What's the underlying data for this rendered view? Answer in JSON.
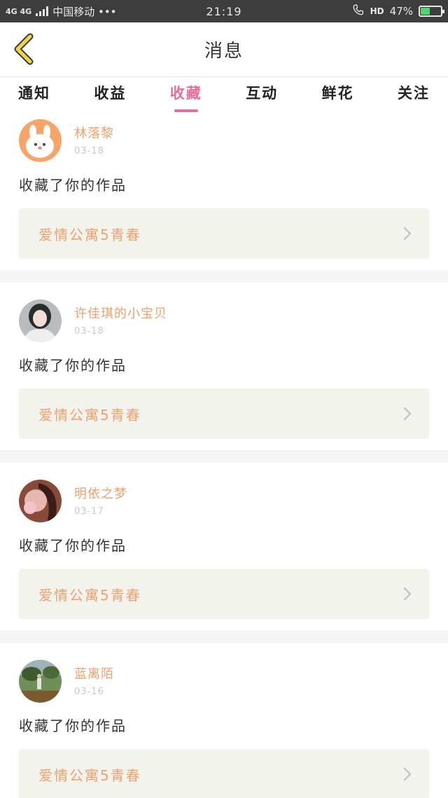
{
  "status_bar": {
    "network": "4G 4G",
    "carrier": "中国移动 •••",
    "time": "21:19",
    "hd": "HD",
    "battery_percent_label": "47%",
    "battery_level": 0.47
  },
  "header": {
    "title": "消息",
    "back_icon": "chevron-left-icon",
    "accent": "#f3d54a"
  },
  "tabs": [
    {
      "label": "通知",
      "active": false
    },
    {
      "label": "收益",
      "active": false
    },
    {
      "label": "收藏",
      "active": true
    },
    {
      "label": "互动",
      "active": false
    },
    {
      "label": "鲜花",
      "active": false
    },
    {
      "label": "关注",
      "active": false
    }
  ],
  "colors": {
    "active_tab": "#e46e9d",
    "username": "#f0a06d",
    "work_title": "#f0a06d",
    "card_bg": "#f3f3ee"
  },
  "messages": [
    {
      "user": "林落黎",
      "date": "03-18",
      "action": "收藏了你的作品",
      "work": "爱情公寓5青春",
      "avatar": "avatar-rabbit"
    },
    {
      "user": "许佳琪的小宝贝",
      "date": "03-18",
      "action": "收藏了你的作品",
      "work": "爱情公寓5青春",
      "avatar": "avatar-girl"
    },
    {
      "user": "明依之梦",
      "date": "03-17",
      "action": "收藏了你的作品",
      "work": "爱情公寓5青春",
      "avatar": "avatar-portrait"
    },
    {
      "user": "蓝离陌",
      "date": "03-16",
      "action": "收藏了你的作品",
      "work": "爱情公寓5青春",
      "avatar": "avatar-landscape"
    }
  ]
}
